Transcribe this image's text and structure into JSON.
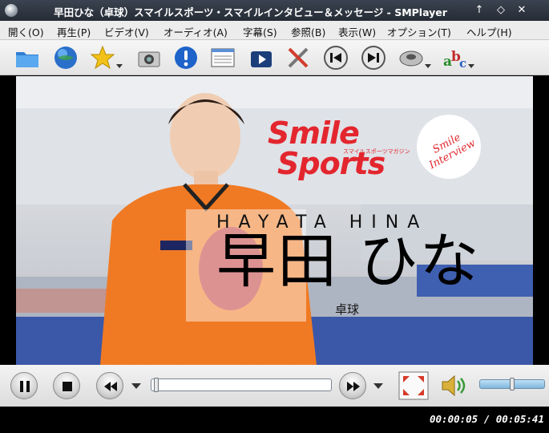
{
  "window": {
    "title": "早田ひな（卓球）スマイルスポーツ・スマイルインタビュー＆メッセージ - SMPlayer",
    "controls": {
      "minimize": "↑",
      "restore": "◇",
      "close": "✕"
    }
  },
  "menu": {
    "items": [
      {
        "label": "開く(O)"
      },
      {
        "label": "再生(P)"
      },
      {
        "label": "ビデオ(V)"
      },
      {
        "label": "オーディオ(A)"
      },
      {
        "label": "字幕(S)"
      },
      {
        "label": "参照(B)"
      },
      {
        "label": "表示(W)"
      },
      {
        "label": "オプション(T)"
      },
      {
        "label": "ヘルプ(H)"
      }
    ]
  },
  "toolbar": {
    "icons": [
      "folder-icon",
      "globe-icon",
      "favorites-star-icon",
      "camera-icon",
      "info-icon",
      "playlist-icon",
      "video-clapper-icon",
      "tools-icon",
      "previous-icon",
      "next-icon",
      "audio-disc-icon",
      "subtitles-abc-icon"
    ]
  },
  "video": {
    "logo_line1": "Smile",
    "logo_line2": "Sports",
    "logo_sub": "スマイルスポーツマガジン",
    "badge_text": "Smile Interview",
    "roman_name": "HAYATA HINA",
    "jp_name": "早田 ひな",
    "sport": "卓球"
  },
  "playback": {
    "progress_fraction": 0.014,
    "volume_fraction": 0.5
  },
  "status": {
    "time": "00:00:05 / 00:05:41"
  },
  "colors": {
    "accent_red": "#e3262e",
    "seek_fill": "#ffffff",
    "volume_fill": "#7fb7dd"
  }
}
